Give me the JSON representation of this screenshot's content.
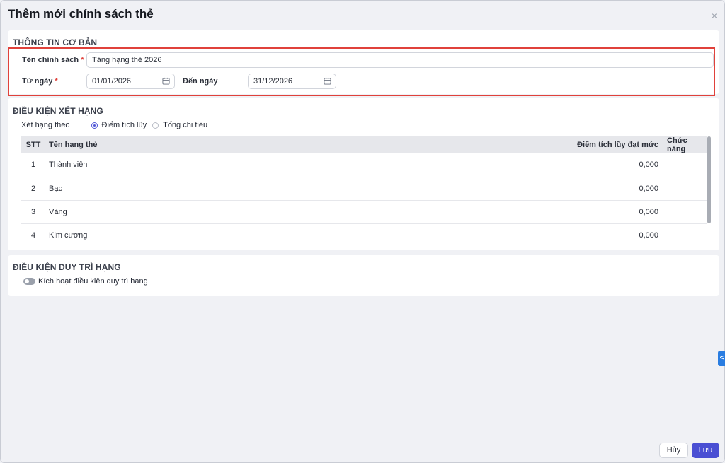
{
  "dialog": {
    "title": "Thêm mới chính sách thẻ",
    "close_glyph": "×"
  },
  "basic": {
    "section_title": "THÔNG TIN CƠ BẢN",
    "name_label": "Tên chính sách",
    "name_value": "Tăng hạng thẻ 2026",
    "from_label": "Từ ngày",
    "from_value": "01/01/2026",
    "to_label": "Đến ngày",
    "to_value": "31/12/2026",
    "required_mark": "*"
  },
  "ranking": {
    "section_title": "ĐIỀU KIỆN XÉT HẠNG",
    "rank_by_label": "Xét hạng theo",
    "options": [
      {
        "label": "Điểm tích lũy",
        "selected": true
      },
      {
        "label": "Tổng chi tiêu",
        "selected": false
      }
    ],
    "columns": [
      "STT",
      "Tên hạng thẻ",
      "Điểm tích lũy đạt mức",
      "Chức năng"
    ],
    "rows": [
      {
        "stt": "1",
        "name": "Thành viên",
        "points": "0,000",
        "actions": ""
      },
      {
        "stt": "2",
        "name": "Bạc",
        "points": "0,000",
        "actions": ""
      },
      {
        "stt": "3",
        "name": "Vàng",
        "points": "0,000",
        "actions": ""
      },
      {
        "stt": "4",
        "name": "Kim cương",
        "points": "0,000",
        "actions": ""
      }
    ]
  },
  "maintain": {
    "section_title": "ĐIỀU KIỆN DUY TRÌ HẠNG",
    "toggle_label": "Kích hoạt điều kiện duy trì hạng",
    "toggle_on": false
  },
  "side_tab_glyph": "<",
  "footer": {
    "cancel_label": "Hủy",
    "save_label": "Lưu"
  },
  "colors": {
    "accent": "#4a4fd3",
    "required": "#e0413b",
    "highlight_border": "#e0413b",
    "side_tab": "#2a7de1"
  }
}
